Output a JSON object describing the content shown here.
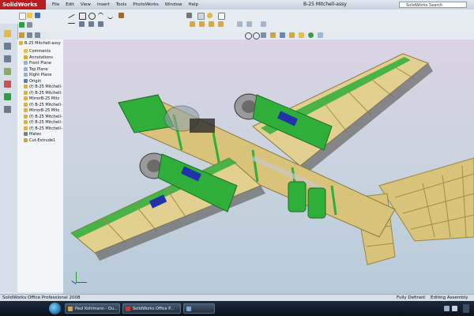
{
  "app": {
    "logo": "SolidWorks",
    "document_title": "B-25 Mitchell-assy"
  },
  "menu": [
    "File",
    "Edit",
    "View",
    "Insert",
    "Tools",
    "PhotoWorks",
    "Window",
    "Help"
  ],
  "search": {
    "placeholder": "SolidWorks Search"
  },
  "tree": {
    "root": "B-25 Mitchell-assy",
    "items": [
      {
        "label": "Comments",
        "icon": "comments-icon",
        "color": "#e3c34a"
      },
      {
        "label": "Annotations",
        "icon": "annotations-icon",
        "color": "#d8a83a"
      },
      {
        "label": "Front Plane",
        "icon": "plane-icon",
        "color": "#9bb0c8"
      },
      {
        "label": "Top Plane",
        "icon": "plane-icon",
        "color": "#9bb0c8"
      },
      {
        "label": "Right Plane",
        "icon": "plane-icon",
        "color": "#9bb0c8"
      },
      {
        "label": "Origin",
        "icon": "origin-icon",
        "color": "#6b7c8e"
      },
      {
        "label": "(f) B-25 Mitchell-",
        "icon": "part-icon",
        "color": "#d9b24a"
      },
      {
        "label": "(f) B-25 Mitchell-",
        "icon": "part-icon",
        "color": "#d9b24a"
      },
      {
        "label": "MirrorB-25 Mitc",
        "icon": "mirror-part-icon",
        "color": "#d9b24a"
      },
      {
        "label": "(f) B-25 Mitchell-",
        "icon": "part-icon",
        "color": "#d9b24a"
      },
      {
        "label": "MirrorB-25 Mitc",
        "icon": "mirror-part-icon",
        "color": "#d9b24a"
      },
      {
        "label": "(f) B-25 Mitchell-",
        "icon": "part-icon",
        "color": "#d9b24a"
      },
      {
        "label": "(f) B-25 Mitchell-",
        "icon": "part-icon",
        "color": "#d9b24a"
      },
      {
        "label": "(f) B-25 Mitchell-",
        "icon": "part-icon",
        "color": "#d9b24a"
      },
      {
        "label": "Mates",
        "icon": "mates-icon",
        "color": "#7a7f86"
      },
      {
        "label": "Cut-Extrude1",
        "icon": "cut-extrude-icon",
        "color": "#c9a04a"
      }
    ]
  },
  "status": {
    "product": "SolidWorks Office Professional 2008",
    "state": "Fully Defined",
    "mode": "Editing Assembly"
  },
  "taskbar": {
    "items": [
      {
        "label": "Paul Kohlmann - Ou..."
      },
      {
        "label": "SolidWorks Office P..."
      },
      {
        "label": ""
      }
    ]
  },
  "colors": {
    "brand": "#b61d21",
    "model_green": "#2fae3a",
    "wood": "#d9c27a"
  }
}
